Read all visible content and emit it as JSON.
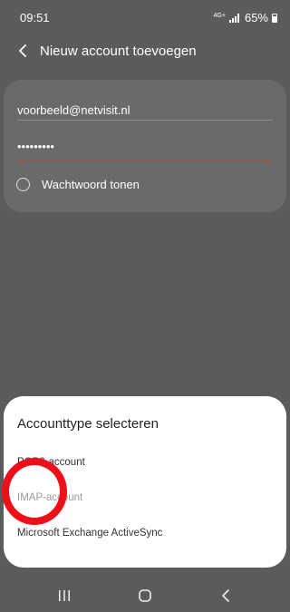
{
  "status_bar": {
    "time": "09:51",
    "network": "4G+",
    "battery": "65%"
  },
  "app_bar": {
    "back_icon": "arrow-left-icon",
    "title": "Nieuw account toevoegen"
  },
  "form": {
    "email": "voorbeeld@netvisit.nl",
    "password_masked": "•••••••••",
    "show_password_label": "Wachtwoord tonen"
  },
  "account_type_sheet": {
    "title": "Accounttype selecteren",
    "options": [
      "POP3-account",
      "IMAP-account",
      "Microsoft Exchange ActiveSync"
    ]
  },
  "nav_bar": {
    "icons": [
      "recents-icon",
      "home-icon",
      "back-icon"
    ]
  },
  "colors": {
    "overlay_background": "#5b5b5b",
    "password_underline": "#a0503a",
    "highlight_ring": "#ef0f1a",
    "sheet_background": "#ffffff"
  }
}
